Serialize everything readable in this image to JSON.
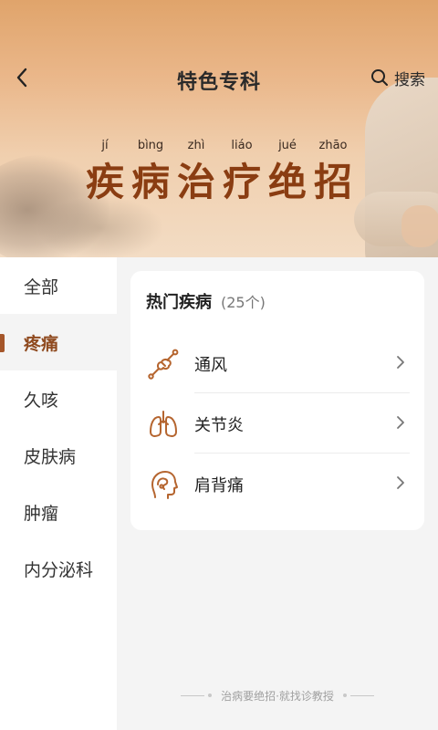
{
  "header": {
    "title": "特色专科",
    "back_icon": "chevron-left-icon",
    "search_icon": "search-icon",
    "search_label": "搜索"
  },
  "hero": {
    "pinyin": [
      "jí",
      "bìng",
      "zhì",
      "liáo",
      "jué",
      "zhāo"
    ],
    "slogan": [
      "疾",
      "病",
      "治",
      "疗",
      "绝",
      "招"
    ]
  },
  "sidebar": {
    "items": [
      {
        "label": "全部",
        "active": false
      },
      {
        "label": "疼痛",
        "active": true
      },
      {
        "label": "久咳",
        "active": false
      },
      {
        "label": "皮肤病",
        "active": false
      },
      {
        "label": "肿瘤",
        "active": false
      },
      {
        "label": "内分泌科",
        "active": false
      }
    ]
  },
  "main": {
    "section_title": "热门疾病",
    "section_count": "(25个)",
    "diseases": [
      {
        "name": "通风",
        "icon": "joint-bone-icon"
      },
      {
        "name": "关节炎",
        "icon": "lungs-icon"
      },
      {
        "name": "肩背痛",
        "icon": "head-profile-icon"
      }
    ]
  },
  "footer": {
    "text": "治病要绝招·就找诊教授"
  },
  "colors": {
    "accent": "#8f4a1f",
    "icon": "#b5652f",
    "slogan": "#8a3d12",
    "background": "#f4f4f4"
  }
}
